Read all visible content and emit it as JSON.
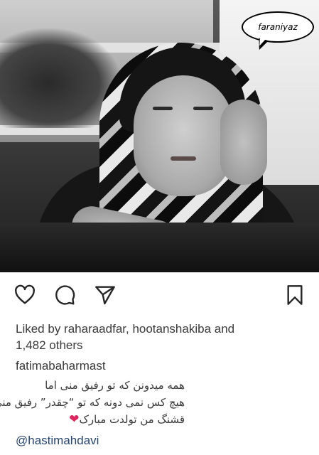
{
  "photo": {
    "watermark": "faraniyaz"
  },
  "actions": {
    "like_icon": "heart-outline-icon",
    "comment_icon": "comment-icon",
    "share_icon": "send-icon",
    "save_icon": "bookmark-icon"
  },
  "likes": {
    "text_line1": "Liked by raharaadfar, hootanshakiba and",
    "text_line2": "1,482 others"
  },
  "post": {
    "author": "fatimabaharmast",
    "caption_lines": [
      "همه میدونن که تو رفیق منی اما",
      "هیچ کس نمی دونه که تو “چقدر” رفیق منی!",
      "قشنگ من تولدت مبارک"
    ],
    "caption_emoji": "❤",
    "mention": "@hastimahdavi"
  },
  "colors": {
    "text": "#3a3a3a",
    "mention": "#27466e",
    "heart_emoji": "#e0245e"
  }
}
